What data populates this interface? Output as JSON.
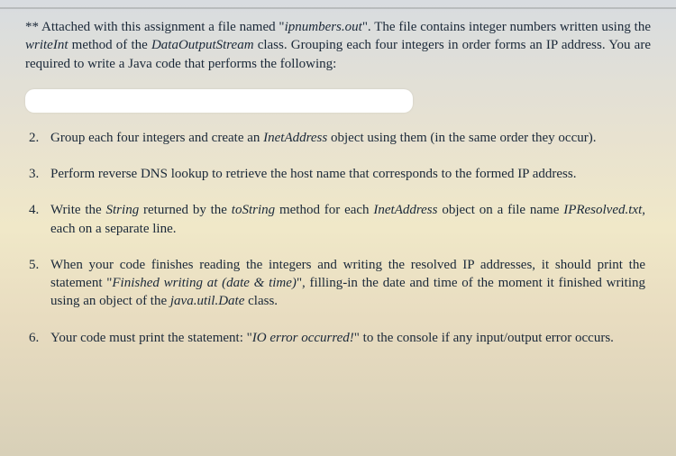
{
  "intro": {
    "prefix": "** Attached with this assignment a file named \"",
    "filename": "ipnumbers.out",
    "mid1": "\". The file contains integer numbers written using the ",
    "method": "writeInt",
    "mid2": " method of the ",
    "classname": "DataOutputStream",
    "tail": " class. Grouping each four integers in order forms an IP address. You are required to write a Java code that performs the following:"
  },
  "items": [
    {
      "num": "2.",
      "pre": "Group each four integers and create an ",
      "it1": "InetAddress",
      "post": " object using them (in the same order they occur)."
    },
    {
      "num": "3.",
      "pre": "Perform reverse DNS lookup to retrieve the host name that corresponds to the formed IP address.",
      "it1": "",
      "post": ""
    },
    {
      "num": "4.",
      "pre": "Write the ",
      "it1": "String",
      "mid1": " returned by the ",
      "it2": "toString",
      "mid2": " method for each ",
      "it3": "InetAddress",
      "mid3": " object on a file name ",
      "it4": "IPResolved.txt",
      "post": ", each on a separate line."
    },
    {
      "num": "5.",
      "pre": "When your code finishes reading the integers and writing the resolved IP addresses, it should print the statement \"",
      "it1": "Finished writing at (date & time)",
      "mid1": "\", filling-in the date and time of the moment it finished writing using an object of the ",
      "it2": "java.util.Date",
      "post": " class."
    },
    {
      "num": "6.",
      "pre": "Your code must print the statement: \"",
      "it1": "IO error occurred!",
      "post": "\" to the console if any input/output error occurs."
    }
  ]
}
